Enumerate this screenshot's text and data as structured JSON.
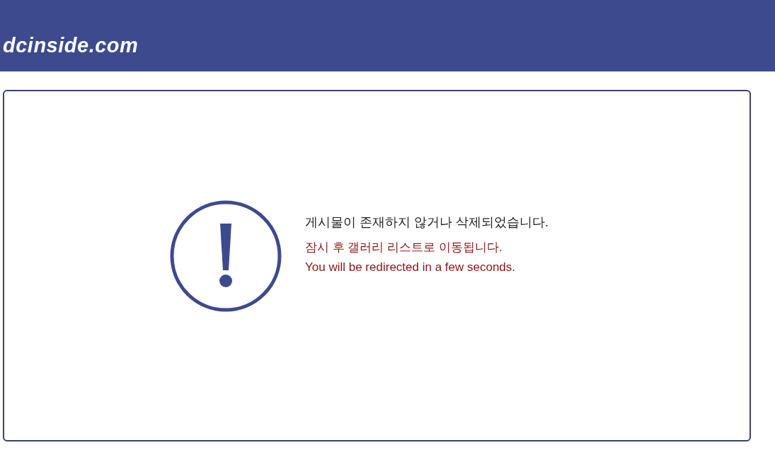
{
  "header": {
    "logo": "dcinside.com"
  },
  "message": {
    "title": "게시물이 존재하지 않거나 삭제되었습니다.",
    "notice_ko": "잠시 후 갤러리 리스트로 이동됩니다.",
    "notice_en": "You will be redirected in a few seconds."
  }
}
